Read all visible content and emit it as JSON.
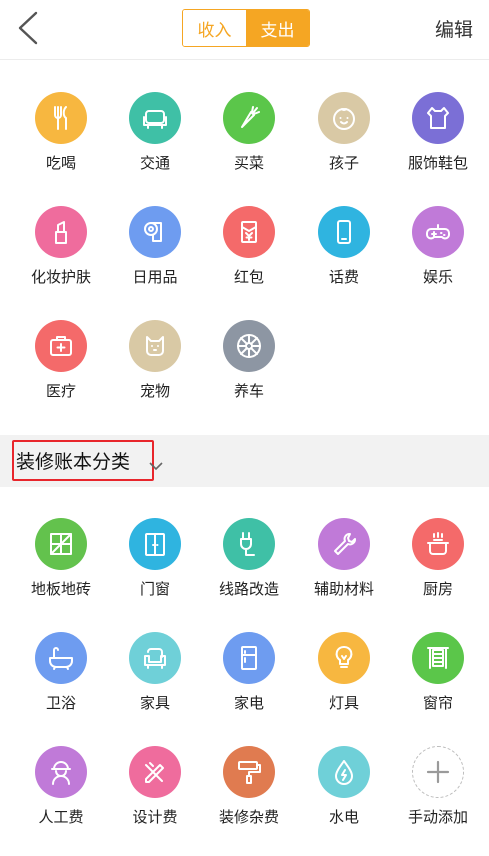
{
  "header": {
    "segment": {
      "income": "收入",
      "expense": "支出",
      "selected": "expense"
    },
    "edit": "编辑"
  },
  "categories_top": [
    {
      "label": "吃喝",
      "icon": "fork-knife-icon",
      "color": "#f7b740"
    },
    {
      "label": "交通",
      "icon": "sofa-seat-icon",
      "color": "#3fc0a6"
    },
    {
      "label": "买菜",
      "icon": "carrot-icon",
      "color": "#5bc64a"
    },
    {
      "label": "孩子",
      "icon": "baby-face-icon",
      "color": "#d9c9a5"
    },
    {
      "label": "服饰鞋包",
      "icon": "shirt-icon",
      "color": "#7b6fd6"
    },
    {
      "label": "化妆护肤",
      "icon": "lipstick-icon",
      "color": "#ef6c9d"
    },
    {
      "label": "日用品",
      "icon": "paper-roll-icon",
      "color": "#6e9cf0"
    },
    {
      "label": "红包",
      "icon": "red-envelope-icon",
      "color": "#f46a6a"
    },
    {
      "label": "话费",
      "icon": "phone-icon",
      "color": "#2fb4e0"
    },
    {
      "label": "娱乐",
      "icon": "gamepad-icon",
      "color": "#c07ad8"
    },
    {
      "label": "医疗",
      "icon": "medical-kit-icon",
      "color": "#f46a6a"
    },
    {
      "label": "宠物",
      "icon": "pet-icon",
      "color": "#d9c9a5"
    },
    {
      "label": "养车",
      "icon": "wheel-icon",
      "color": "#8d96a3"
    }
  ],
  "section": {
    "title": "装修账本分类"
  },
  "categories_reno": [
    {
      "label": "地板地砖",
      "icon": "floor-tile-icon",
      "color": "#63c24d"
    },
    {
      "label": "门窗",
      "icon": "door-icon",
      "color": "#2fb4e0"
    },
    {
      "label": "线路改造",
      "icon": "plug-icon",
      "color": "#3fc0a6"
    },
    {
      "label": "辅助材料",
      "icon": "wrench-icon",
      "color": "#c07ad8"
    },
    {
      "label": "厨房",
      "icon": "pot-icon",
      "color": "#f46a6a"
    },
    {
      "label": "卫浴",
      "icon": "bathtub-icon",
      "color": "#6e9cf0"
    },
    {
      "label": "家具",
      "icon": "armchair-icon",
      "color": "#6fd0d8"
    },
    {
      "label": "家电",
      "icon": "fridge-icon",
      "color": "#6e9cf0"
    },
    {
      "label": "灯具",
      "icon": "light-bulb-icon",
      "color": "#f7b740"
    },
    {
      "label": "窗帘",
      "icon": "curtain-icon",
      "color": "#5bc64a"
    },
    {
      "label": "人工费",
      "icon": "worker-icon",
      "color": "#c07ad8"
    },
    {
      "label": "设计费",
      "icon": "ruler-pencil-icon",
      "color": "#ef6c9d"
    },
    {
      "label": "装修杂费",
      "icon": "paint-roller-icon",
      "color": "#e07b50"
    },
    {
      "label": "水电",
      "icon": "water-drop-icon",
      "color": "#6fd0d8"
    },
    {
      "label": "手动添加",
      "icon": "plus-icon",
      "color": "#ffffff"
    }
  ]
}
